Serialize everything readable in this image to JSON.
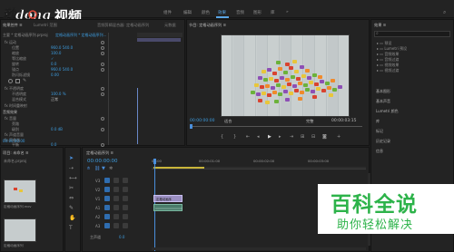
{
  "watermark": {
    "logo_text": "视频",
    "baike_title": "百科全说",
    "baike_subtitle": "助你轻松解决"
  },
  "workspace_tabs": [
    {
      "label": "组件"
    },
    {
      "label": "编辑"
    },
    {
      "label": "颜色"
    },
    {
      "label": "效果",
      "active": true
    },
    {
      "label": "音频"
    },
    {
      "label": "图形"
    },
    {
      "label": "库"
    },
    {
      "label": "»"
    }
  ],
  "effect_controls": {
    "tabs": [
      "效果控件 ≡",
      "Lumetri 范围",
      "音频剪辑混合器: 定格动画序列",
      "元数据"
    ],
    "header": "主要 * 定格动画序列.prproj",
    "clip_header": "定格动画序列 * 定格动画序列...",
    "sections": [
      {
        "label": "fx 运动",
        "value": ""
      },
      {
        "label": "位置",
        "value": "960.0  540.0"
      },
      {
        "label": "缩放",
        "value": "100.0"
      },
      {
        "label": "等比缩放",
        "value": "✓"
      },
      {
        "label": "旋转",
        "value": "0.0"
      },
      {
        "label": "锚点",
        "value": "960.0  540.0"
      },
      {
        "label": "防闪烁滤镜",
        "value": "0.00"
      },
      {
        "label": "fx 不透明度",
        "value": ""
      },
      {
        "label": "不透明度",
        "value": "100.0 %"
      },
      {
        "label": "混合模式",
        "value": "正常"
      },
      {
        "label": "fx 时间重映射",
        "value": ""
      },
      {
        "label": "音频效果",
        "value": ""
      },
      {
        "label": "fx 音量",
        "value": ""
      },
      {
        "label": "旁路",
        "value": ""
      },
      {
        "label": "级别",
        "value": "0.0 dB"
      },
      {
        "label": "fx 声道音量",
        "value": ""
      },
      {
        "label": "fx 声像器",
        "value": ""
      },
      {
        "label": "平衡",
        "value": "0.0"
      }
    ],
    "timecode": "00:00:00:00"
  },
  "program_monitor": {
    "title": "节目: 定格动画序列 ≡",
    "timecode": "00:00:00:00",
    "fit": "适合",
    "quality": "完整",
    "duration": "00:00:03:15"
  },
  "right_panel": {
    "title": "效果 ≡",
    "search_placeholder": "",
    "folders": [
      "预设",
      "Lumetri 预设",
      "音频效果",
      "音频过渡",
      "视频效果",
      "视频过渡"
    ],
    "sections": [
      "基本图形",
      "基本声音",
      "Lumetri 颜色",
      "库",
      "标记",
      "历史记录",
      "信息"
    ]
  },
  "project": {
    "title": "项目: 未命名 ≡",
    "file": "未命名.prproj",
    "items": [
      {
        "name": "定格动画序列.mov",
        "duration": "3:15"
      },
      {
        "name": "定格动画序列",
        "duration": "3:15"
      }
    ]
  },
  "timeline": {
    "tab": "定格动画序列 ≡",
    "timecode": "00:00:00:00",
    "ruler_labels": [
      "00:00",
      "00:00:01:00",
      "00:00:02:00",
      "00:00:03:00"
    ],
    "tracks": [
      {
        "name": "V3"
      },
      {
        "name": "V2"
      },
      {
        "name": "V1"
      },
      {
        "name": "A1"
      },
      {
        "name": "A2"
      },
      {
        "name": "A3"
      },
      {
        "name": "主声道",
        "value": "0.0"
      }
    ],
    "video_clip_label": "定格动画序列.mov [V]",
    "audio_clip_label": ""
  }
}
